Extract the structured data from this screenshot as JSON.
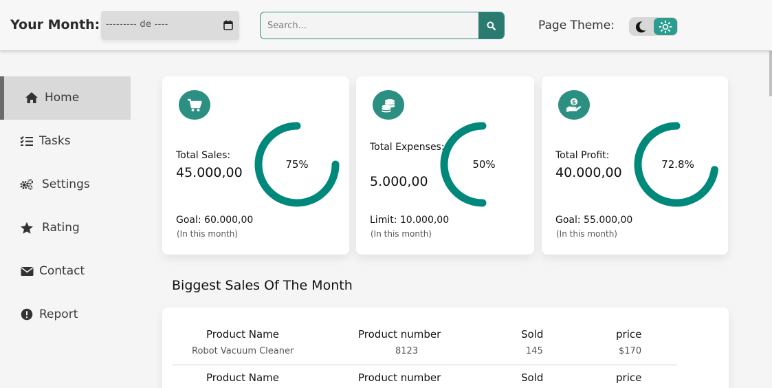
{
  "header": {
    "month_label": "Your Month:",
    "month_value": "--------- de ----",
    "search_placeholder": "Search...",
    "theme_label": "Page Theme:"
  },
  "sidebar": {
    "items": [
      {
        "label": "Home",
        "icon": "home-icon",
        "active": true
      },
      {
        "label": "Tasks",
        "icon": "tasks-icon"
      },
      {
        "label": "Settings",
        "icon": "gears-icon"
      },
      {
        "label": "Rating",
        "icon": "star-icon"
      },
      {
        "label": "Contact",
        "icon": "envelope-icon"
      },
      {
        "label": "Report",
        "icon": "alert-icon"
      }
    ]
  },
  "cards": [
    {
      "icon": "cart-icon",
      "title": "Total Sales:",
      "value": "45.000,00",
      "percent": 75,
      "percent_label": "75%",
      "limit": "Goal: 60.000,00",
      "note": "(In this month)"
    },
    {
      "icon": "coins-icon",
      "title": "Total Expenses:",
      "value": "5.000,00",
      "percent": 50,
      "percent_label": "50%",
      "limit": "Limit: 10.000,00",
      "note": "(In this month)"
    },
    {
      "icon": "hand-dollar-icon",
      "title": "Total Profit:",
      "value": "40.000,00",
      "percent": 72.8,
      "percent_label": "72.8%",
      "limit": "Goal: 55.000,00",
      "note": "(In this month)"
    }
  ],
  "sales": {
    "title": "Biggest Sales Of The Month",
    "columns": [
      "Product Name",
      "Product number",
      "Sold",
      "price"
    ],
    "rows": [
      [
        "Robot Vacuum Cleaner",
        "8123",
        "145",
        "$170"
      ]
    ],
    "columns_repeat": [
      "Product Name",
      "Product number",
      "Sold",
      "price"
    ]
  },
  "colors": {
    "accent": "#00897b",
    "accent_dark": "#2b7a70",
    "card_bg": "#ffffff",
    "page_bg": "#f5f5f5"
  }
}
